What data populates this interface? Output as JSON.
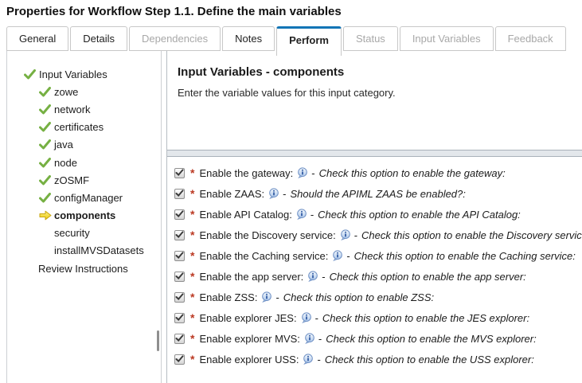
{
  "title": "Properties for Workflow Step 1.1. Define the main variables",
  "tabs": [
    {
      "label": "General",
      "state": "normal"
    },
    {
      "label": "Details",
      "state": "normal"
    },
    {
      "label": "Dependencies",
      "state": "disabled"
    },
    {
      "label": "Notes",
      "state": "normal"
    },
    {
      "label": "Perform",
      "state": "active"
    },
    {
      "label": "Status",
      "state": "disabled"
    },
    {
      "label": "Input Variables",
      "state": "disabled"
    },
    {
      "label": "Feedback",
      "state": "disabled"
    }
  ],
  "sidebar": {
    "items": [
      {
        "label": "Input Variables",
        "icon": "check",
        "level": 0,
        "bold": false
      },
      {
        "label": "zowe",
        "icon": "check",
        "level": 1,
        "bold": false
      },
      {
        "label": "network",
        "icon": "check",
        "level": 1,
        "bold": false
      },
      {
        "label": "certificates",
        "icon": "check",
        "level": 1,
        "bold": false
      },
      {
        "label": "java",
        "icon": "check",
        "level": 1,
        "bold": false
      },
      {
        "label": "node",
        "icon": "check",
        "level": 1,
        "bold": false
      },
      {
        "label": "zOSMF",
        "icon": "check",
        "level": 1,
        "bold": false
      },
      {
        "label": "configManager",
        "icon": "check",
        "level": 1,
        "bold": false
      },
      {
        "label": "components",
        "icon": "arrow",
        "level": 1,
        "bold": true
      },
      {
        "label": "security",
        "icon": "none",
        "level": 1,
        "bold": false
      },
      {
        "label": "installMVSDatasets",
        "icon": "none",
        "level": 1,
        "bold": false
      },
      {
        "label": "Review Instructions",
        "icon": "none",
        "level": 0,
        "bold": false
      }
    ]
  },
  "main": {
    "heading": "Input Variables - components",
    "subtitle": "Enter the variable values for this input category.",
    "required_marker": "*",
    "separator": "-",
    "rows": [
      {
        "label": "Enable the gateway:",
        "desc": "Check this option to enable the gateway:",
        "checked": true
      },
      {
        "label": "Enable ZAAS:",
        "desc": "Should the APIML ZAAS be enabled?:",
        "checked": true
      },
      {
        "label": "Enable API Catalog:",
        "desc": "Check this option to enable the API Catalog:",
        "checked": true
      },
      {
        "label": "Enable the Discovery service:",
        "desc": "Check this option to enable the Discovery service:",
        "checked": true
      },
      {
        "label": "Enable the Caching service:",
        "desc": "Check this option to enable the Caching service:",
        "checked": true
      },
      {
        "label": "Enable the app server:",
        "desc": "Check this option to enable the app server:",
        "checked": true
      },
      {
        "label": "Enable ZSS:",
        "desc": "Check this option to enable ZSS:",
        "checked": true
      },
      {
        "label": "Enable explorer JES:",
        "desc": "Check this option to enable the JES explorer:",
        "checked": true
      },
      {
        "label": "Enable explorer MVS:",
        "desc": "Check this option to enable the MVS explorer:",
        "checked": true
      },
      {
        "label": "Enable explorer USS:",
        "desc": "Check this option to enable the USS explorer:",
        "checked": true
      }
    ]
  },
  "colors": {
    "active_tab_accent": "#1375b6",
    "check_green": "#76b043",
    "arrow_yellow": "#f2d411",
    "required_red": "#bb3922",
    "disabled_text": "#a8a8a8",
    "border_gray": "#c8c8c8",
    "splitter_fill": "#e3e7eb"
  }
}
